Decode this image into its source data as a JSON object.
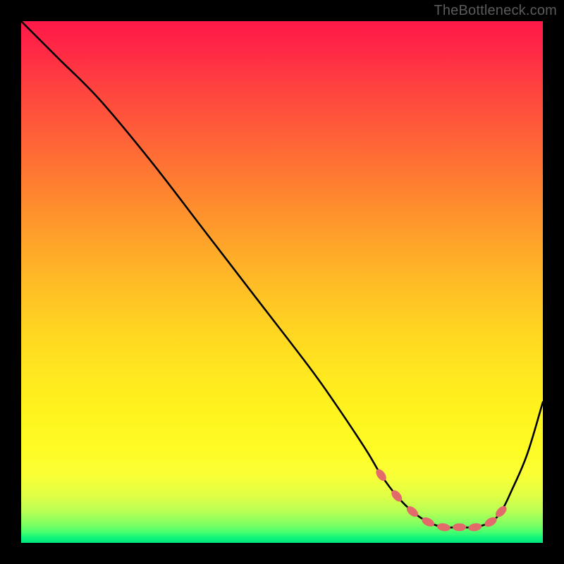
{
  "watermark": "TheBottleneck.com",
  "chart_data": {
    "type": "line",
    "title": "",
    "xlabel": "",
    "ylabel": "",
    "xlim": [
      0,
      100
    ],
    "ylim": [
      0,
      100
    ],
    "grid": false,
    "series": [
      {
        "name": "curve",
        "x": [
          0,
          7,
          15,
          25,
          35,
          45,
          55,
          60,
          66,
          69,
          72,
          75,
          78,
          81,
          84,
          87,
          90,
          92,
          94,
          97,
          100
        ],
        "y": [
          100,
          93,
          85,
          73,
          60,
          47,
          34,
          27,
          18,
          13,
          9,
          6,
          4,
          3,
          3,
          3,
          4,
          6,
          10,
          17,
          27
        ],
        "color": "#000000"
      },
      {
        "name": "dotted-highlight",
        "x": [
          69,
          72,
          75,
          78,
          81,
          84,
          87,
          90,
          92
        ],
        "y": [
          13,
          9,
          6,
          4,
          3,
          3,
          3,
          4,
          6
        ],
        "color": "#e26a6a"
      }
    ]
  },
  "colors": {
    "frame": "#000000",
    "gradient_top": "#ff1948",
    "gradient_bottom": "#00e47d",
    "curve": "#000000",
    "dots": "#e26a6a",
    "watermark": "#5b5b5b"
  }
}
